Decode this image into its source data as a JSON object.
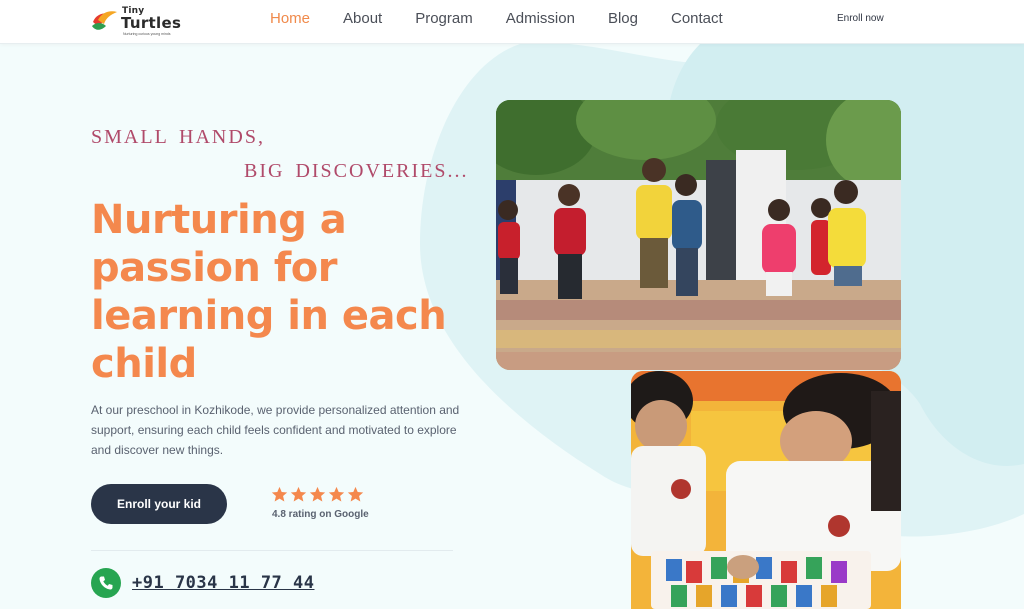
{
  "brand": {
    "tiny": "Tiny",
    "name": "Turtles",
    "tagline": "Nurturing curious young minds"
  },
  "nav": {
    "items": [
      {
        "label": "Home",
        "active": true
      },
      {
        "label": "About",
        "active": false
      },
      {
        "label": "Program",
        "active": false
      },
      {
        "label": "Admission",
        "active": false
      },
      {
        "label": "Blog",
        "active": false
      },
      {
        "label": "Contact",
        "active": false
      }
    ],
    "cta": "Enroll now"
  },
  "hero": {
    "kicker_line1": "SMALL HANDS,",
    "kicker_line2": "BIG DISCOVERIES...",
    "headline": "Nurturing a passion for learning in each child",
    "description": "At our preschool in Kozhikode, we provide personalized attention and support, ensuring each child feels confident and motivated to explore and discover new things.",
    "cta_label": "Enroll your kid",
    "rating_text": "4.8 rating on Google",
    "rating_value": 4.8,
    "stars": 5,
    "phone": "+91 7034 11 77 44"
  },
  "colors": {
    "accent": "#f4884d",
    "kicker": "#b04a6a",
    "dark_button": "#2a3548",
    "phone_green": "#27a551",
    "blob": "#dff3f5"
  },
  "icons": {
    "phone": "phone-icon",
    "star": "star-icon",
    "logo": "turtle-logo-icon"
  }
}
